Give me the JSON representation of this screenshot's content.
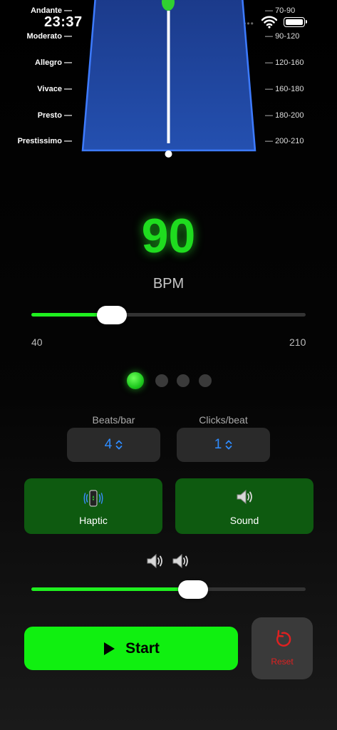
{
  "status_bar": {
    "time": "23:37"
  },
  "tempo_markings": [
    {
      "name": "Andante",
      "range": "70-90"
    },
    {
      "name": "Moderato",
      "range": "90-120"
    },
    {
      "name": "Allegro",
      "range": "120-160"
    },
    {
      "name": "Vivace",
      "range": "160-180"
    },
    {
      "name": "Presto",
      "range": "180-200"
    },
    {
      "name": "Prestissimo",
      "range": "200-210"
    }
  ],
  "bpm": {
    "value": "90",
    "label": "BPM"
  },
  "tempo_slider": {
    "min": "40",
    "max": "210",
    "value": 90
  },
  "beat_indicator": {
    "count": 4,
    "active": 0
  },
  "beats_bar": {
    "label": "Beats/bar",
    "value": "4"
  },
  "clicks_beat": {
    "label": "Clicks/beat",
    "value": "1"
  },
  "haptic": {
    "label": "Haptic"
  },
  "sound": {
    "label": "Sound"
  },
  "volume_slider": {
    "fraction": 0.59
  },
  "start": {
    "label": "Start"
  },
  "reset": {
    "label": "Reset"
  },
  "colors": {
    "accent_green": "#10f010",
    "toggle_green": "#0e5a10",
    "picker_blue": "#2f8cff",
    "reset_red": "#e02020"
  }
}
